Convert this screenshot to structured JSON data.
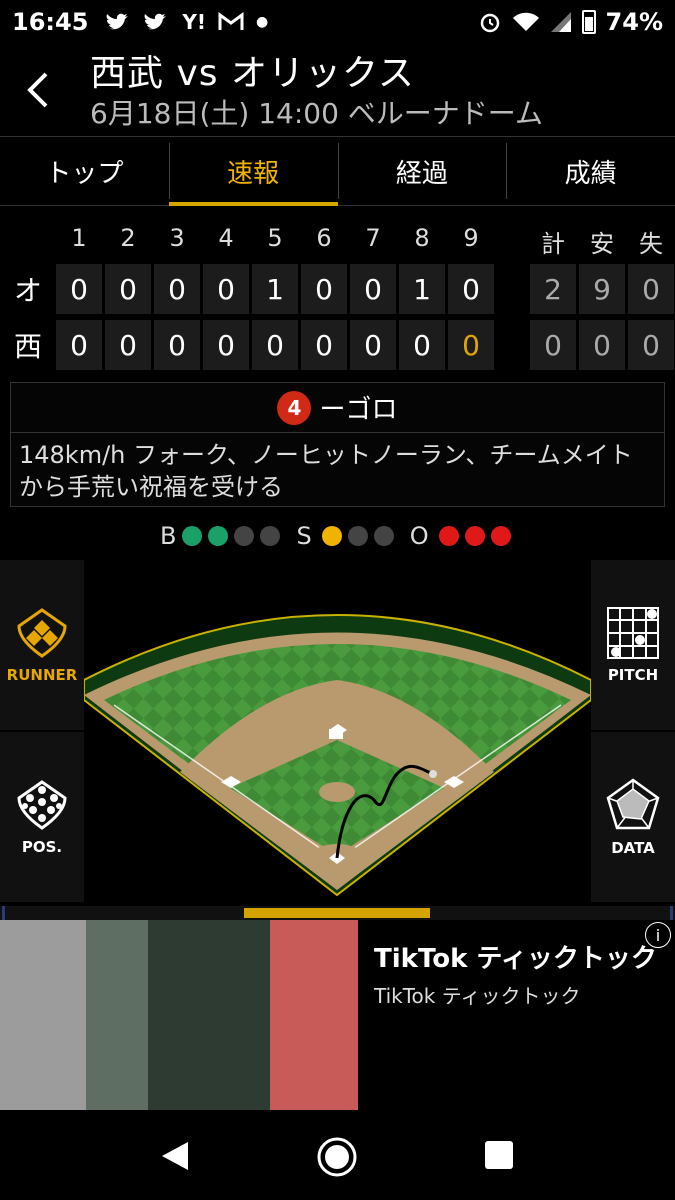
{
  "status": {
    "time": "16:45",
    "battery": "74%",
    "notification_icons": [
      "twitter-icon",
      "twitter-icon",
      "yahoo-icon",
      "gmail-icon",
      "dot-icon"
    ]
  },
  "header": {
    "title": "西武 vs オリックス",
    "subtitle": "6月18日(土) 14:00 ベルーナドーム"
  },
  "tabs": [
    {
      "label": "トップ",
      "active": false
    },
    {
      "label": "速報",
      "active": true
    },
    {
      "label": "経過",
      "active": false
    },
    {
      "label": "成績",
      "active": false
    }
  ],
  "scoreboard": {
    "innings": [
      "1",
      "2",
      "3",
      "4",
      "5",
      "6",
      "7",
      "8",
      "9"
    ],
    "totals_headers": [
      "計",
      "安",
      "失"
    ],
    "rows": [
      {
        "team": "オ",
        "scores": [
          "0",
          "0",
          "0",
          "0",
          "1",
          "0",
          "0",
          "1",
          "0"
        ],
        "totals": [
          "2",
          "9",
          "0"
        ]
      },
      {
        "team": "西",
        "scores": [
          "0",
          "0",
          "0",
          "0",
          "0",
          "0",
          "0",
          "0",
          "0"
        ],
        "totals": [
          "0",
          "0",
          "0"
        ]
      }
    ]
  },
  "play": {
    "position_number": "4",
    "result": "ーゴロ",
    "description": "148km/h フォーク、ノーヒットノーラン、チームメイトから手荒い祝福を受ける"
  },
  "count": {
    "balls_label": "B",
    "strikes_label": "S",
    "outs_label": "O",
    "balls": 2,
    "balls_max": 4,
    "strikes": 1,
    "strikes_max": 3,
    "outs": 3,
    "outs_max": 3,
    "colors": {
      "ball": "#1ca06a",
      "strike": "#f0b400",
      "out": "#e01818",
      "empty": "#444444"
    }
  },
  "side_buttons": {
    "runner": "RUNNER",
    "pitch": "PITCH",
    "pos": "POS.",
    "data": "DATA"
  },
  "ad": {
    "title": "TikTok ティックトック",
    "subtitle": "TikTok ティックトック",
    "info": "i"
  },
  "colors": {
    "accent": "#f0b400",
    "field_green": "#3e8a34",
    "infield_dirt": "#b89a6e"
  }
}
